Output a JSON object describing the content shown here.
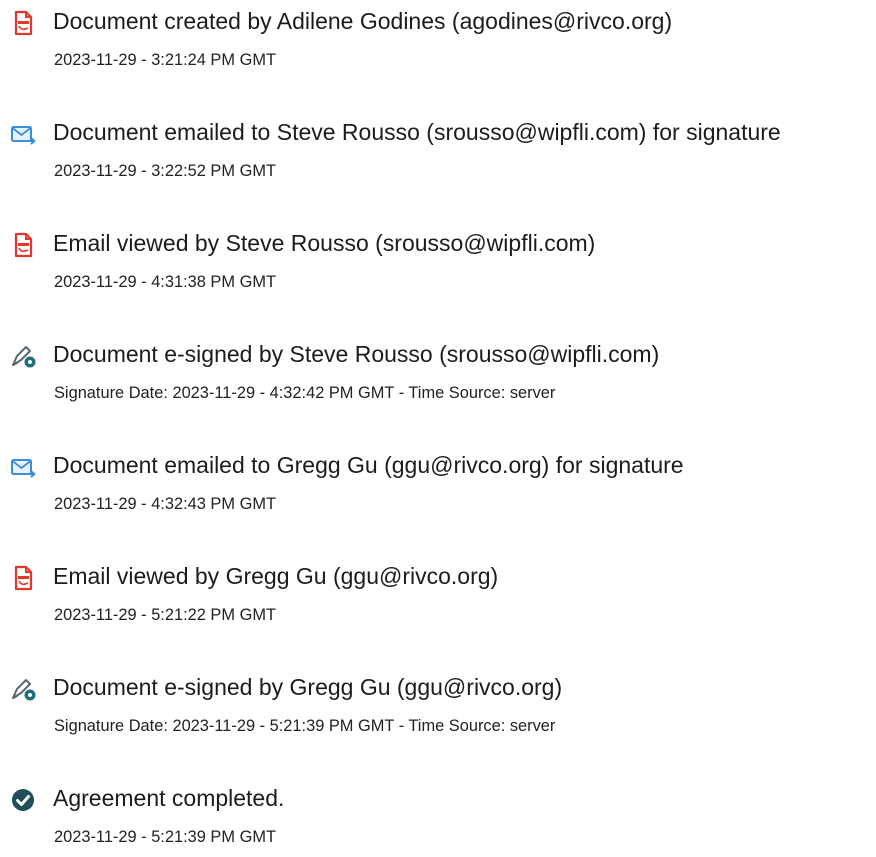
{
  "events": [
    {
      "icon": "document-icon",
      "title": "Document created by Adilene Godines (agodines@rivco.org)",
      "detail": "2023-11-29 - 3:21:24 PM GMT"
    },
    {
      "icon": "email-sent-icon",
      "title": "Document emailed to Steve Rousso (srousso@wipfli.com) for signature",
      "detail": "2023-11-29 - 3:22:52 PM GMT"
    },
    {
      "icon": "document-icon",
      "title": "Email viewed by Steve Rousso (srousso@wipfli.com)",
      "detail": "2023-11-29 - 4:31:38 PM GMT"
    },
    {
      "icon": "e-sign-pen-icon",
      "title": "Document e-signed by Steve Rousso (srousso@wipfli.com)",
      "detail": "Signature Date: 2023-11-29 - 4:32:42 PM GMT - Time Source: server"
    },
    {
      "icon": "email-sent-icon",
      "title": "Document emailed to Gregg Gu (ggu@rivco.org) for signature",
      "detail": "2023-11-29 - 4:32:43 PM GMT"
    },
    {
      "icon": "document-icon",
      "title": "Email viewed by Gregg Gu (ggu@rivco.org)",
      "detail": "2023-11-29 - 5:21:22 PM GMT"
    },
    {
      "icon": "e-sign-pen-icon",
      "title": "Document e-signed by Gregg Gu (ggu@rivco.org)",
      "detail": "Signature Date: 2023-11-29 - 5:21:39 PM GMT - Time Source: server"
    },
    {
      "icon": "checkmark-circle-icon",
      "title": "Agreement completed.",
      "detail": "2023-11-29 - 5:21:39 PM GMT"
    }
  ],
  "colors": {
    "document_icon": "#e0382c",
    "email_icon": "#3b8fd9",
    "pen_icon": "#5b6770",
    "check_icon": "#1f4f57"
  }
}
